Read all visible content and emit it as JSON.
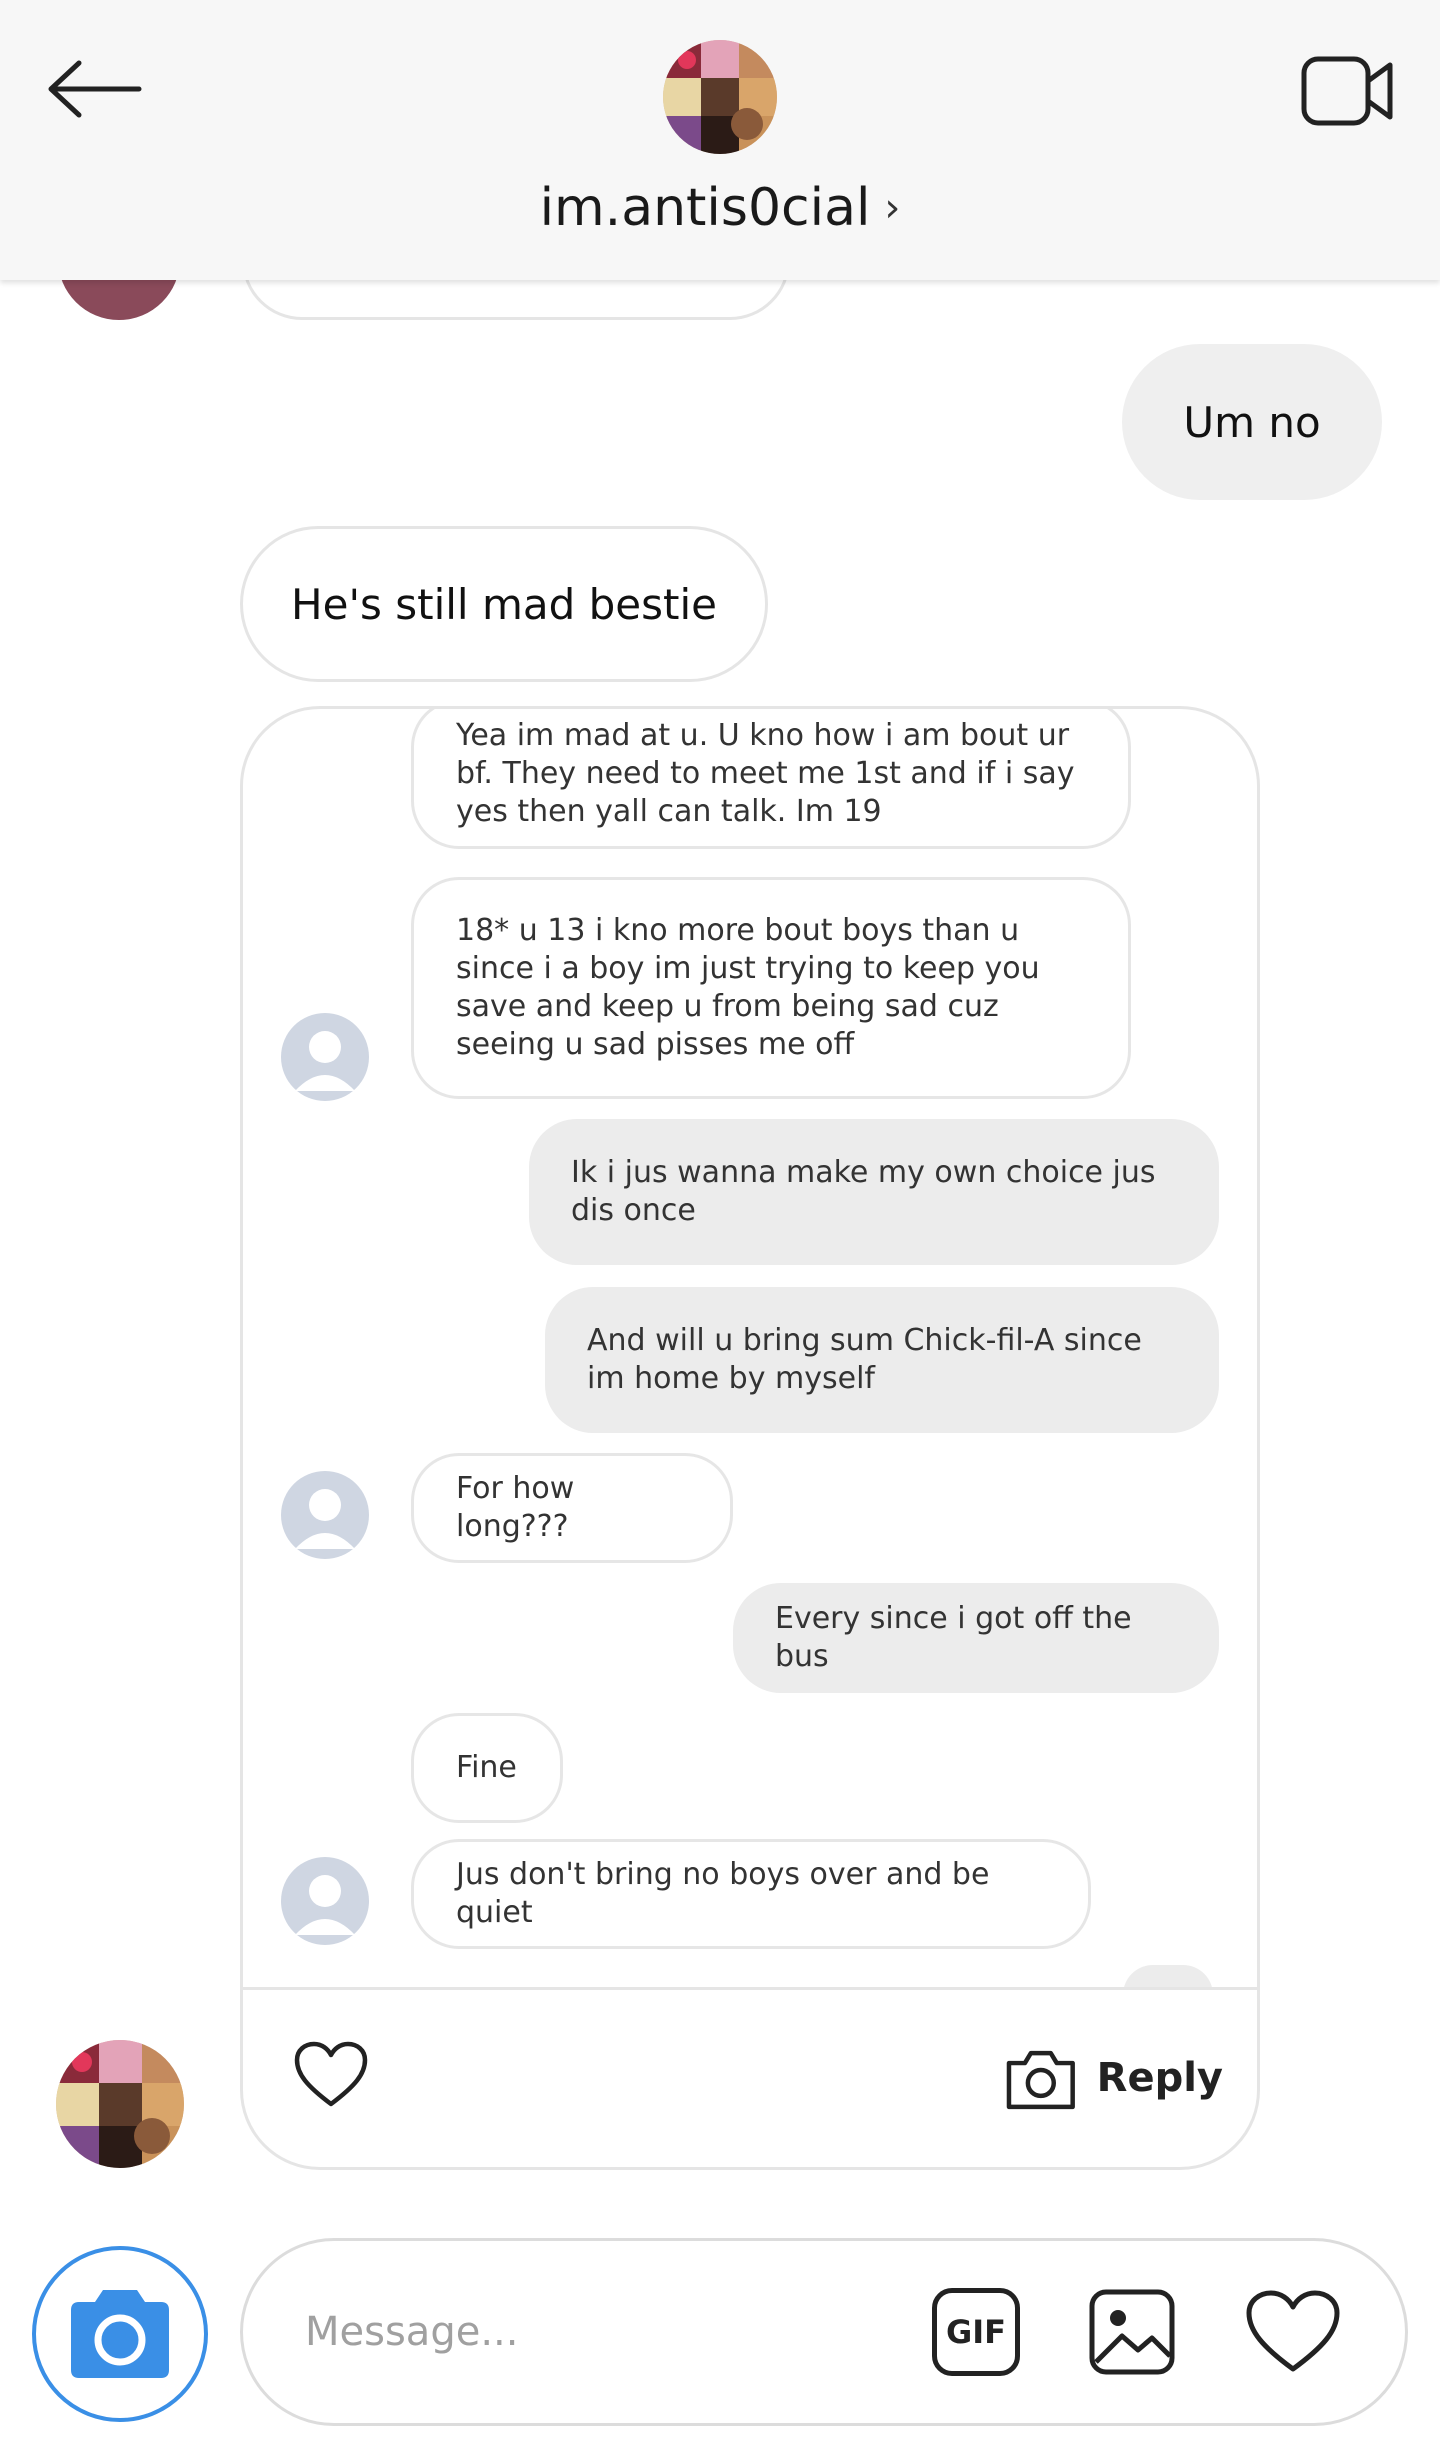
{
  "header": {
    "username": "im.antis0cial",
    "chevron": "›",
    "icons": {
      "back": "back-arrow-icon",
      "video": "video-call-icon"
    }
  },
  "messages": [
    {
      "dir": "out",
      "text": "Um no"
    },
    {
      "dir": "in",
      "text": "He's still mad bestie"
    }
  ],
  "shared_screenshot": {
    "messages": [
      {
        "dir": "in",
        "text": "Yea im mad at u. U kno how i am bout ur bf. They need to meet me 1st and if i say yes then yall can talk. Im 19"
      },
      {
        "dir": "in",
        "text": "18* u 13 i kno more bout boys than u since i a boy im just trying to keep you save and keep u from being sad cuz seeing u sad pisses me off"
      },
      {
        "dir": "out",
        "text": "Ik i jus wanna make my own choice jus dis once"
      },
      {
        "dir": "out",
        "text": "And will u bring sum Chick-fil-A since im home by myself"
      },
      {
        "dir": "in",
        "text": "For how long???"
      },
      {
        "dir": "out",
        "text": "Every since i got off the bus"
      },
      {
        "dir": "in",
        "text": "Fine"
      },
      {
        "dir": "in",
        "text": "Jus don't bring no boys over and be quiet"
      }
    ]
  },
  "card_actions": {
    "reply_label": "Reply"
  },
  "composer": {
    "placeholder": "Message...",
    "gif_label": "GIF"
  },
  "colors": {
    "accent": "#3a8fe6",
    "outgoing_bubble": "#efefef",
    "border": "#e5e5e5"
  }
}
